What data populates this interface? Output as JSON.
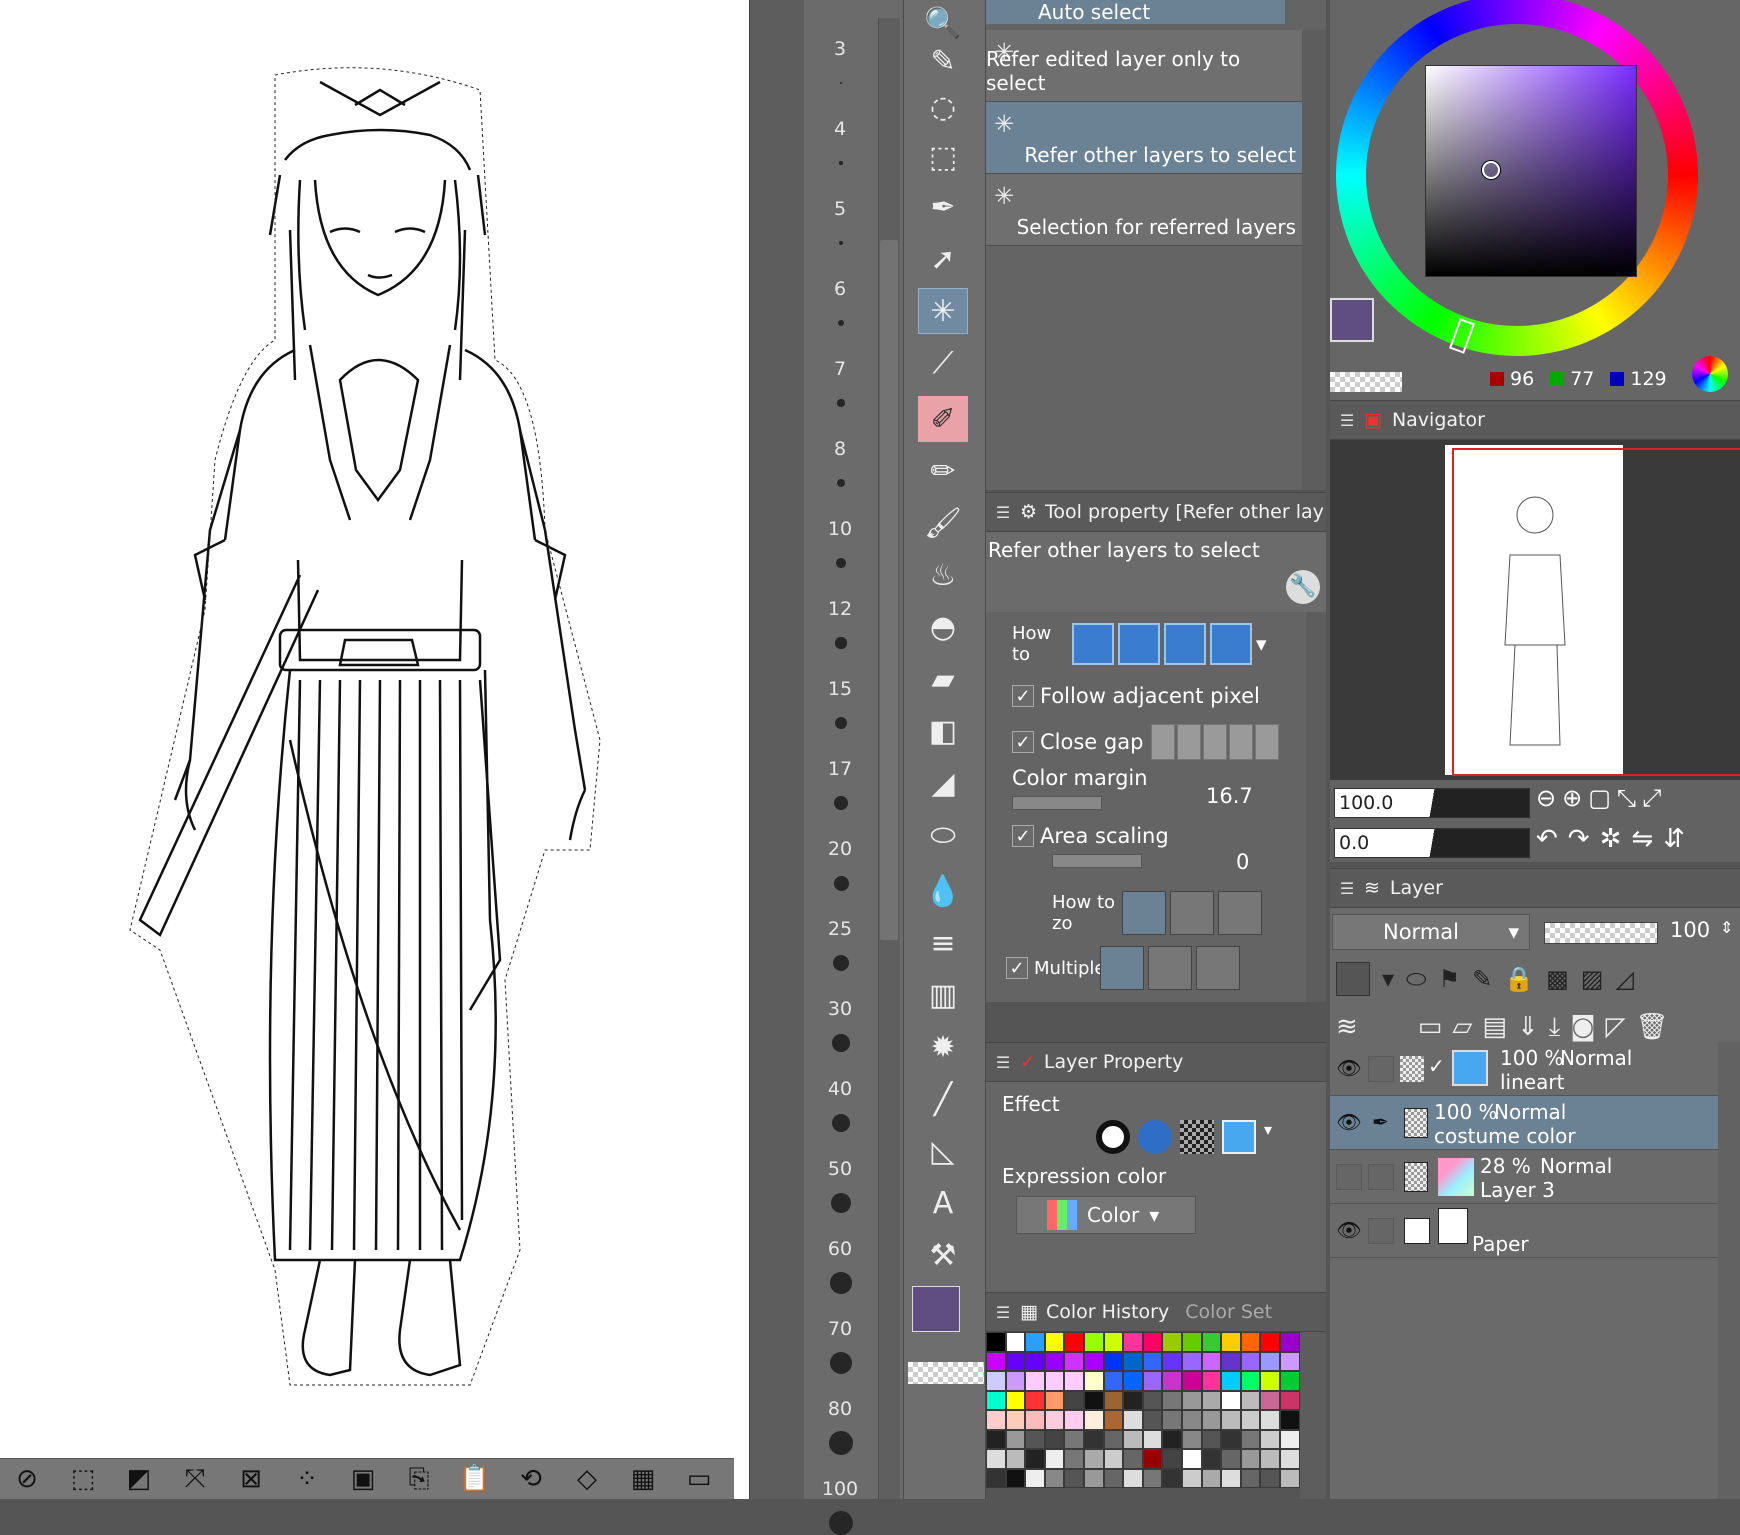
{
  "subtool": {
    "items": [
      {
        "label": "Auto select"
      },
      {
        "label": "Refer edited layer only to select"
      },
      {
        "label": "Refer other layers to select"
      },
      {
        "label": "Selection for referred layers"
      }
    ]
  },
  "brush_sizes": [
    "3",
    "4",
    "5",
    "6",
    "7",
    "8",
    "10",
    "12",
    "15",
    "17",
    "20",
    "25",
    "30",
    "40",
    "50",
    "60",
    "70",
    "80",
    "100"
  ],
  "tool_property": {
    "title": "Tool property [Refer other lay",
    "name": "Refer other layers to select",
    "how_to": "How to",
    "follow_adjacent": "Follow adjacent pixel",
    "close_gap": "Close gap",
    "color_margin": "Color margin",
    "color_margin_value": "16.7",
    "area_scaling": "Area scaling",
    "area_scaling_value": "0",
    "how_to_zoom": "How to zo",
    "multiple": "Multiple"
  },
  "layer_property": {
    "title": "Layer Property",
    "effect": "Effect",
    "expression_color": "Expression color",
    "color_mode": "Color"
  },
  "color_history": {
    "title": "Color History",
    "tab2": "Color Set"
  },
  "color": {
    "r": "96",
    "g": "77",
    "b": "129",
    "main": "#604d81"
  },
  "navigator": {
    "title": "Navigator",
    "zoom": "100.0",
    "rotate": "0.0"
  },
  "layer_panel": {
    "title": "Layer",
    "blend_mode": "Normal",
    "opacity": "100",
    "layers": [
      {
        "opacity": "100 %",
        "mode": "Normal",
        "name": "lineart"
      },
      {
        "opacity": "100 %",
        "mode": "Normal",
        "name": "costume color"
      },
      {
        "opacity": "28 %",
        "mode": "Normal",
        "name": "Layer 3"
      },
      {
        "opacity": "",
        "mode": "",
        "name": "Paper"
      }
    ]
  }
}
